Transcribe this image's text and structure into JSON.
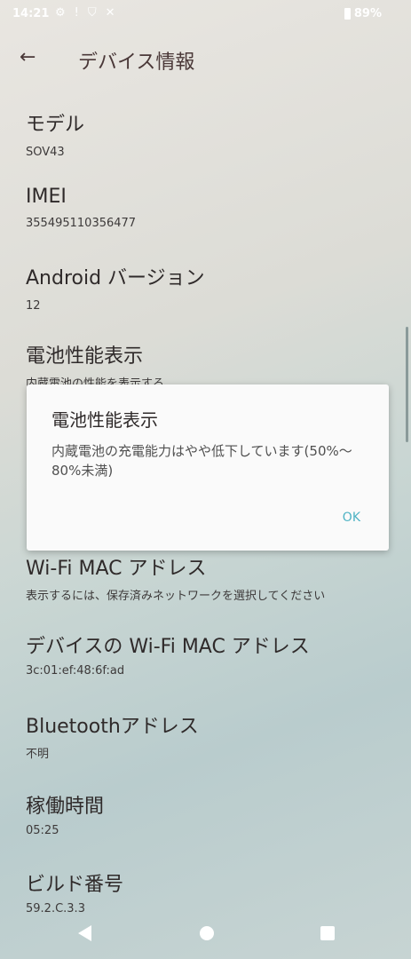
{
  "status_bar": {
    "time": "14:21",
    "icons": [
      "gear-icon",
      "alert-icon",
      "shield-icon",
      "tools-icon"
    ],
    "battery": "89%"
  },
  "app_bar": {
    "title": "デバイス情報"
  },
  "items": [
    {
      "title": "モデル",
      "value": "SOV43"
    },
    {
      "title": "IMEI",
      "value": "355495110356477"
    },
    {
      "title": "Android バージョン",
      "value": "12"
    },
    {
      "title": "電池性能表示",
      "value": "内蔵電池の性能を表示する"
    },
    {
      "title": "Wi-Fi MAC アドレス",
      "value": "表示するには、保存済みネットワークを選択してください"
    },
    {
      "title": "デバイスの Wi-Fi MAC アドレス",
      "value": "3c:01:ef:48:6f:ad"
    },
    {
      "title": "Bluetoothアドレス",
      "value": "不明"
    },
    {
      "title": "稼働時間",
      "value": "05:25"
    },
    {
      "title": "ビルド番号",
      "value": "59.2.C.3.3"
    }
  ],
  "dialog": {
    "title": "電池性能表示",
    "message": "内蔵電池の充電能力はやや低下しています(50%〜80%未満)",
    "ok_label": "OK"
  },
  "colors": {
    "dialog_button": "#4fb3c4",
    "dialog_bg": "#fafafa"
  }
}
